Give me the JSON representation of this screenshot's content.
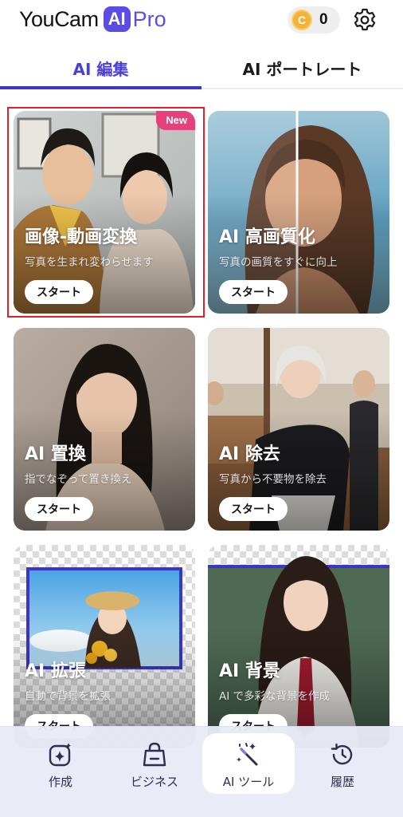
{
  "header": {
    "logo_text": "YouCam",
    "logo_badge": "AI",
    "logo_suffix": "Pro",
    "coin_symbol": "C",
    "coin_count": "0",
    "icons": [
      "coin-icon",
      "gear-icon"
    ]
  },
  "tabs": [
    {
      "label": "AI 編集",
      "active": true
    },
    {
      "label": "AI ポートレート",
      "active": false
    }
  ],
  "cards": [
    {
      "title": "画像-動画変換",
      "subtitle": "写真を生まれ変わらせます",
      "button": "スタート",
      "badge": "New"
    },
    {
      "title": "AI 高画質化",
      "subtitle": "写真の画質をすぐに向上",
      "button": "スタート"
    },
    {
      "title": "AI 置換",
      "subtitle": "指でなぞって置き換え",
      "button": "スタート"
    },
    {
      "title": "AI 除去",
      "subtitle": "写真から不要物を除去",
      "button": "スタート"
    },
    {
      "title": "AI 拡張",
      "subtitle": "自動で背景を拡張",
      "button": "スタート"
    },
    {
      "title": "AI 背景",
      "subtitle": "AI で多彩な背景を作成",
      "button": "スタート"
    }
  ],
  "bottom_nav": [
    {
      "label": "作成",
      "icon": "sparkle-square-icon",
      "active": false
    },
    {
      "label": "ビジネス",
      "icon": "shopping-bag-icon",
      "active": false
    },
    {
      "label": "AI ツール",
      "icon": "magic-wand-icon",
      "active": true
    },
    {
      "label": "履歴",
      "icon": "history-clock-icon",
      "active": false
    }
  ],
  "colors": {
    "brand": "#5b4ce8",
    "tab_active": "#4a3fd6",
    "new_badge": "#e6407d",
    "selection": "#e01f2c",
    "coin": "#f2b33a"
  }
}
